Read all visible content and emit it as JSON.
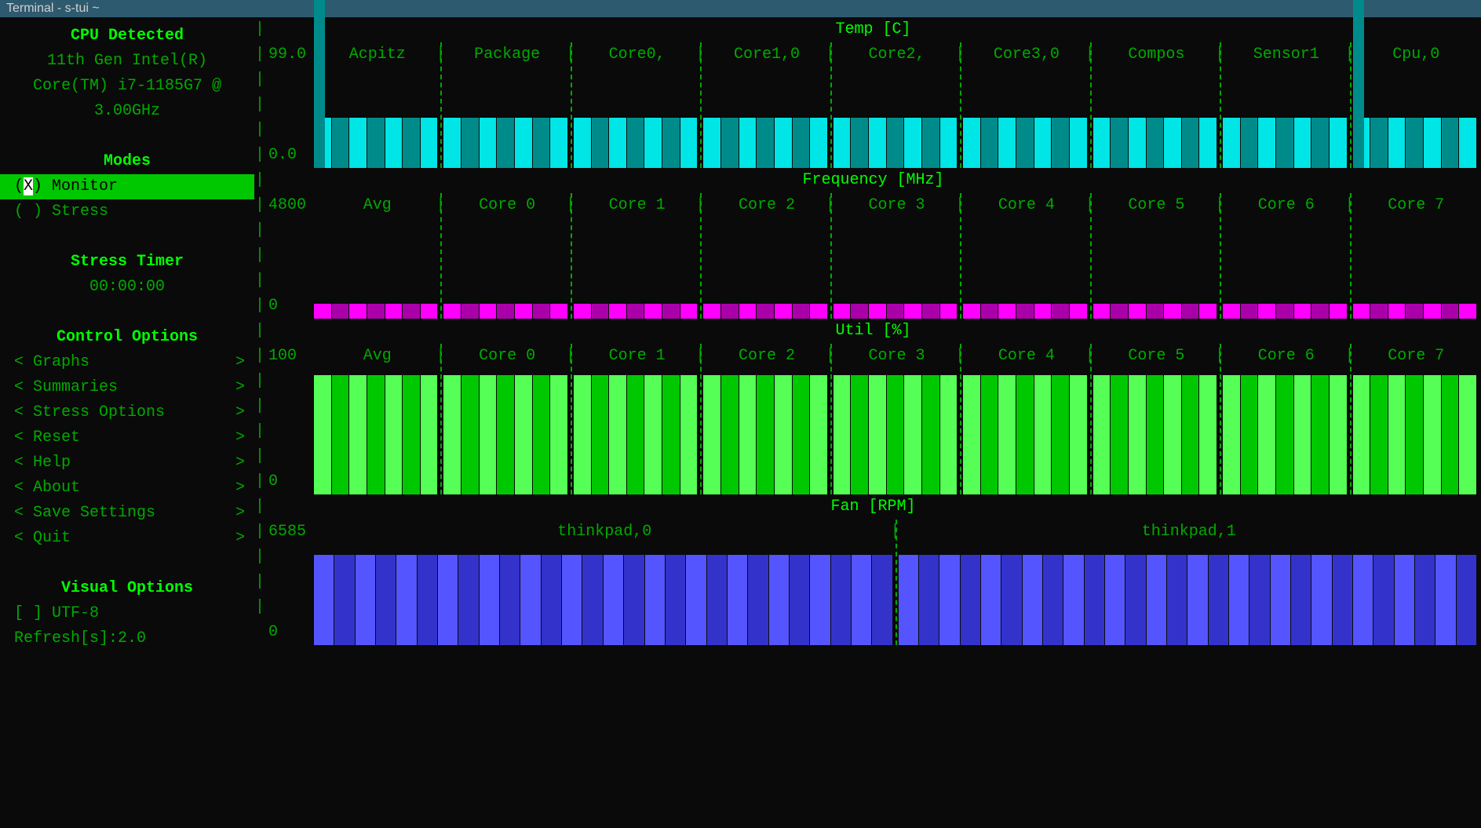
{
  "titlebar": "Terminal - s-tui ~",
  "sidebar": {
    "cpu_detected_heading": "CPU Detected",
    "cpu_line1": "11th Gen Intel(R)",
    "cpu_line2": "Core(TM) i7-1185G7 @",
    "cpu_line3": "3.00GHz",
    "modes_heading": "Modes",
    "modes": [
      {
        "mark": "X",
        "label": "Monitor",
        "selected": true
      },
      {
        "mark": " ",
        "label": "Stress",
        "selected": false
      }
    ],
    "stress_timer_heading": "Stress Timer",
    "stress_timer_value": "00:00:00",
    "control_options_heading": "Control Options",
    "control_options": [
      "Graphs",
      "Summaries",
      "Stress Options",
      "Reset",
      "Help",
      "About",
      "Save Settings",
      "Quit"
    ],
    "visual_options_heading": "Visual Options",
    "utf8_label": "[ ] UTF-8",
    "refresh_label": "Refresh[s]:2.0"
  },
  "graphs": {
    "temp": {
      "title": "Temp [C]",
      "max": "99.0",
      "min": "0.0",
      "cols": [
        "Acpitz",
        "Package",
        "Core0,",
        "Core1,0",
        "Core2,",
        "Core3,0",
        "Compos",
        "Sensor1",
        "Cpu,0"
      ]
    },
    "freq": {
      "title": "Frequency [MHz]",
      "max": "4800",
      "min": "0",
      "cols": [
        "Avg",
        "Core 0",
        "Core 1",
        "Core 2",
        "Core 3",
        "Core 4",
        "Core 5",
        "Core 6",
        "Core 7"
      ]
    },
    "util": {
      "title": "Util [%]",
      "max": "100",
      "min": "0",
      "cols": [
        "Avg",
        "Core 0",
        "Core 1",
        "Core 2",
        "Core 3",
        "Core 4",
        "Core 5",
        "Core 6",
        "Core 7"
      ]
    },
    "fan": {
      "title": "Fan [RPM]",
      "max": "6585",
      "min": "0",
      "cols": [
        "thinkpad,0",
        "thinkpad,1"
      ]
    }
  },
  "chart_data": [
    {
      "type": "bar",
      "title": "Temp [C]",
      "ylim": [
        0.0,
        99.0
      ],
      "categories": [
        "Acpitz",
        "Package",
        "Core0,",
        "Core1,0",
        "Core2,",
        "Core3,0",
        "Compos",
        "Sensor1",
        "Cpu,0"
      ],
      "values_approx_pct": [
        50,
        50,
        50,
        50,
        50,
        50,
        50,
        50,
        50
      ],
      "note": "Each category shows history stripes ~50% height; Acpitz and Cpu,0 have a single higher spike ~80-90%."
    },
    {
      "type": "bar",
      "title": "Frequency [MHz]",
      "ylim": [
        0,
        4800
      ],
      "categories": [
        "Avg",
        "Core 0",
        "Core 1",
        "Core 2",
        "Core 3",
        "Core 4",
        "Core 5",
        "Core 6",
        "Core 7"
      ],
      "values_approx_pct": [
        6,
        6,
        6,
        6,
        6,
        6,
        6,
        6,
        6
      ],
      "note": "All bars very short, near baseline (~0-300 MHz range)."
    },
    {
      "type": "bar",
      "title": "Util [%]",
      "ylim": [
        0,
        100
      ],
      "categories": [
        "Avg",
        "Core 0",
        "Core 1",
        "Core 2",
        "Core 3",
        "Core 4",
        "Core 5",
        "Core 6",
        "Core 7"
      ],
      "values_approx_pct": [
        95,
        95,
        95,
        95,
        95,
        95,
        95,
        95,
        95
      ],
      "note": "All near 100%."
    },
    {
      "type": "bar",
      "title": "Fan [RPM]",
      "ylim": [
        0,
        6585
      ],
      "categories": [
        "thinkpad,0",
        "thinkpad,1"
      ],
      "values_approx_pct": [
        90,
        90
      ],
      "note": "Both fans near max."
    }
  ]
}
